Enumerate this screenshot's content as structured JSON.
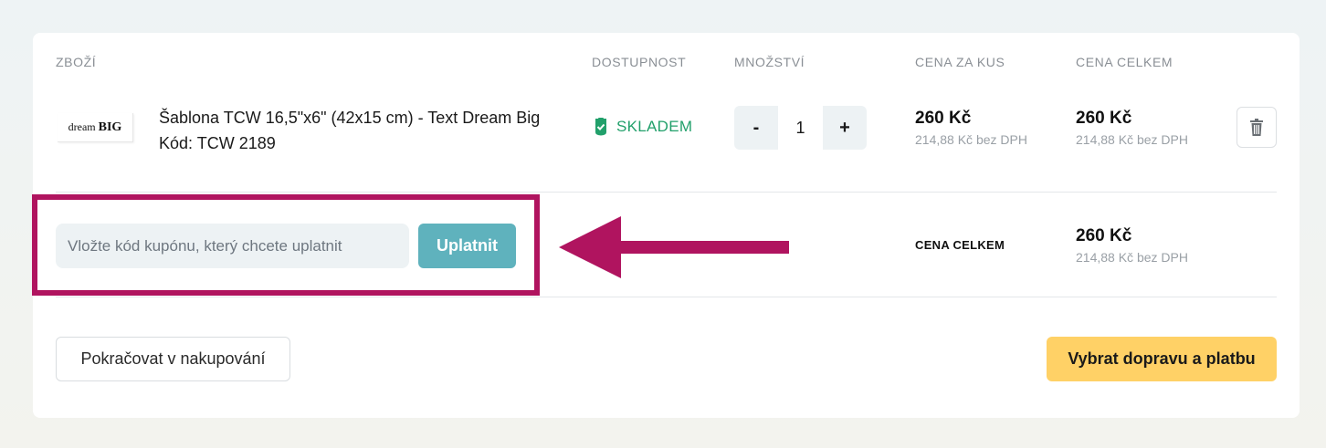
{
  "table": {
    "headers": {
      "product": "ZBOŽÍ",
      "availability": "DOSTUPNOST",
      "quantity": "MNOŽSTVÍ",
      "unit_price": "CENA ZA KUS",
      "total_price": "CENA CELKEM"
    }
  },
  "item": {
    "thumbnail_text_script": "dream",
    "thumbnail_text_bold": "BIG",
    "name": "Šablona TCW 16,5\"x6\" (42x15 cm) - Text Dream Big",
    "code": "Kód: TCW 2189",
    "availability": "SKLADEM",
    "quantity": "1",
    "qty_minus": "-",
    "qty_plus": "+",
    "unit_price": "260 Kč",
    "unit_price_net": "214,88 Kč bez DPH",
    "total_price": "260 Kč",
    "total_price_net": "214,88 Kč bez DPH"
  },
  "coupon": {
    "placeholder": "Vložte kód kupónu, který chcete uplatnit",
    "apply_label": "Uplatnit"
  },
  "summary": {
    "label": "CENA CELKEM",
    "total": "260 Kč",
    "total_net": "214,88 Kč bez DPH"
  },
  "actions": {
    "continue_label": "Pokračovat v nakupování",
    "checkout_label": "Vybrat dopravu a platbu"
  },
  "icons": {
    "availability": "shield-check-icon",
    "remove": "trash-icon",
    "annotation": "arrow-left-icon"
  },
  "colors": {
    "accent_teal": "#5fb2bd",
    "in_stock_green": "#22a06b",
    "checkout_yellow": "#ffd166",
    "annotation_magenta": "#b0145f"
  }
}
